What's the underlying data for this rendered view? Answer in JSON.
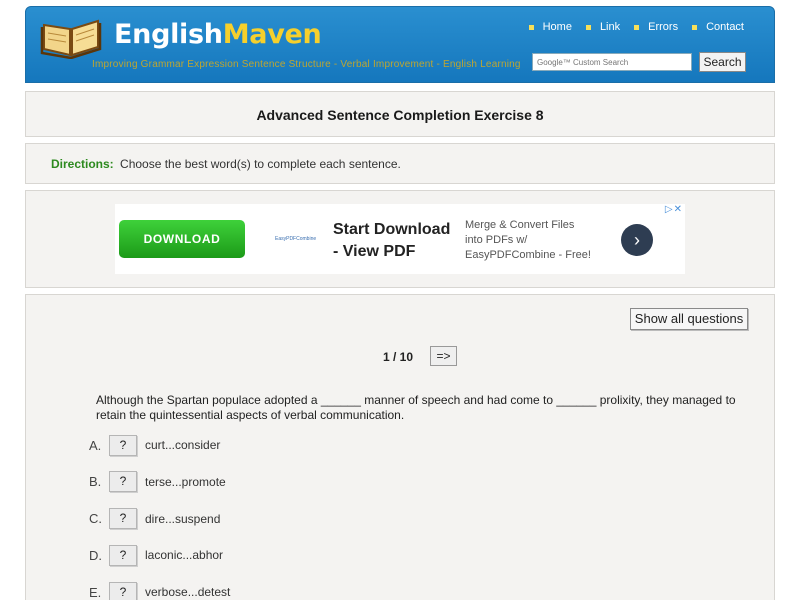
{
  "header": {
    "logo_english": "English",
    "logo_maven": "Maven",
    "tagline": "Improving Grammar Expression Sentence Structure - Verbal Improvement - English Learning",
    "nav": [
      "Home",
      "Link",
      "Errors",
      "Contact"
    ],
    "search_placeholder": "Google™ Custom Search",
    "search_button": "Search"
  },
  "title": "Advanced Sentence Completion Exercise 8",
  "directions": {
    "label": "Directions:",
    "text": "Choose the best word(s) to complete each sentence."
  },
  "ad": {
    "download_label": "DOWNLOAD",
    "small_logo": "EasyPDFCombine",
    "headline": "Start Download - View PDF",
    "description": "Merge & Convert Files into PDFs w/ EasyPDFCombine - Free!",
    "choices": "▷✕"
  },
  "quiz": {
    "show_all_label": "Show all questions",
    "counter": "1 / 10",
    "next_label": "=>",
    "question": "Although the Spartan populace adopted a ______ manner of speech and had come to ______ prolixity, they managed to retain the quintessential aspects of verbal communication.",
    "options": [
      {
        "letter": "A.",
        "button": "?",
        "text": "curt...consider"
      },
      {
        "letter": "B.",
        "button": "?",
        "text": "terse...promote"
      },
      {
        "letter": "C.",
        "button": "?",
        "text": "dire...suspend"
      },
      {
        "letter": "D.",
        "button": "?",
        "text": "laconic...abhor"
      },
      {
        "letter": "E.",
        "button": "?",
        "text": "verbose...detest"
      }
    ]
  },
  "colors": {
    "header_blue": "#1a7fc4",
    "logo_yellow": "#f6d02c",
    "directions_green": "#2d8a1f",
    "panel_bg": "#f4f3f1"
  }
}
